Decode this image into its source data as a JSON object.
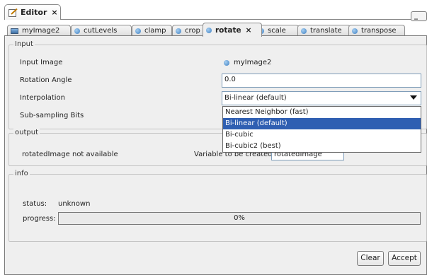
{
  "window": {
    "tab_title": "Editor",
    "close_glyph": "×",
    "icon": "editor-icon",
    "minimize_glyph": "_ □"
  },
  "tabs": [
    {
      "label": "myImage2",
      "icon": "image-icon"
    },
    {
      "label": "cutLevels",
      "icon": "circle-icon"
    },
    {
      "label": "clamp",
      "icon": "circle-icon"
    },
    {
      "label": "crop",
      "icon": "circle-icon"
    },
    {
      "label": "rotate",
      "icon": "circle-icon",
      "active": true,
      "close": "×"
    },
    {
      "label": "scale",
      "icon": "circle-icon"
    },
    {
      "label": "translate",
      "icon": "circle-icon"
    },
    {
      "label": "transpose",
      "icon": "circle-icon"
    }
  ],
  "input_group": {
    "legend": "Input",
    "input_image_label": "Input Image",
    "input_image_value": "myImage2",
    "rotation_angle_label": "Rotation Angle",
    "rotation_angle_value": "0.0",
    "interpolation_label": "Interpolation",
    "interpolation_value": "Bi-linear (default)",
    "interpolation_options": [
      "Nearest Neighbor (fast)",
      "Bi-linear (default)",
      "Bi-cubic",
      "Bi-cubic2 (best)"
    ],
    "interpolation_selected_index": 1,
    "subsampling_label": "Sub-sampling Bits"
  },
  "output_group": {
    "legend": "output",
    "status_text": "rotatedImage  not available",
    "variable_label": "Variable to be created",
    "variable_value": "rotatedImage"
  },
  "info_group": {
    "legend": "info",
    "status_label": "status:",
    "status_value": "unknown",
    "progress_label": "progress:",
    "progress_text": "0%",
    "progress_value": 0
  },
  "buttons": {
    "clear": "Clear",
    "accept": "Accept"
  },
  "colors": {
    "selection": "#2f5fb2",
    "tab_dot": "#3d7fc2",
    "panel_bg": "#efefef"
  }
}
